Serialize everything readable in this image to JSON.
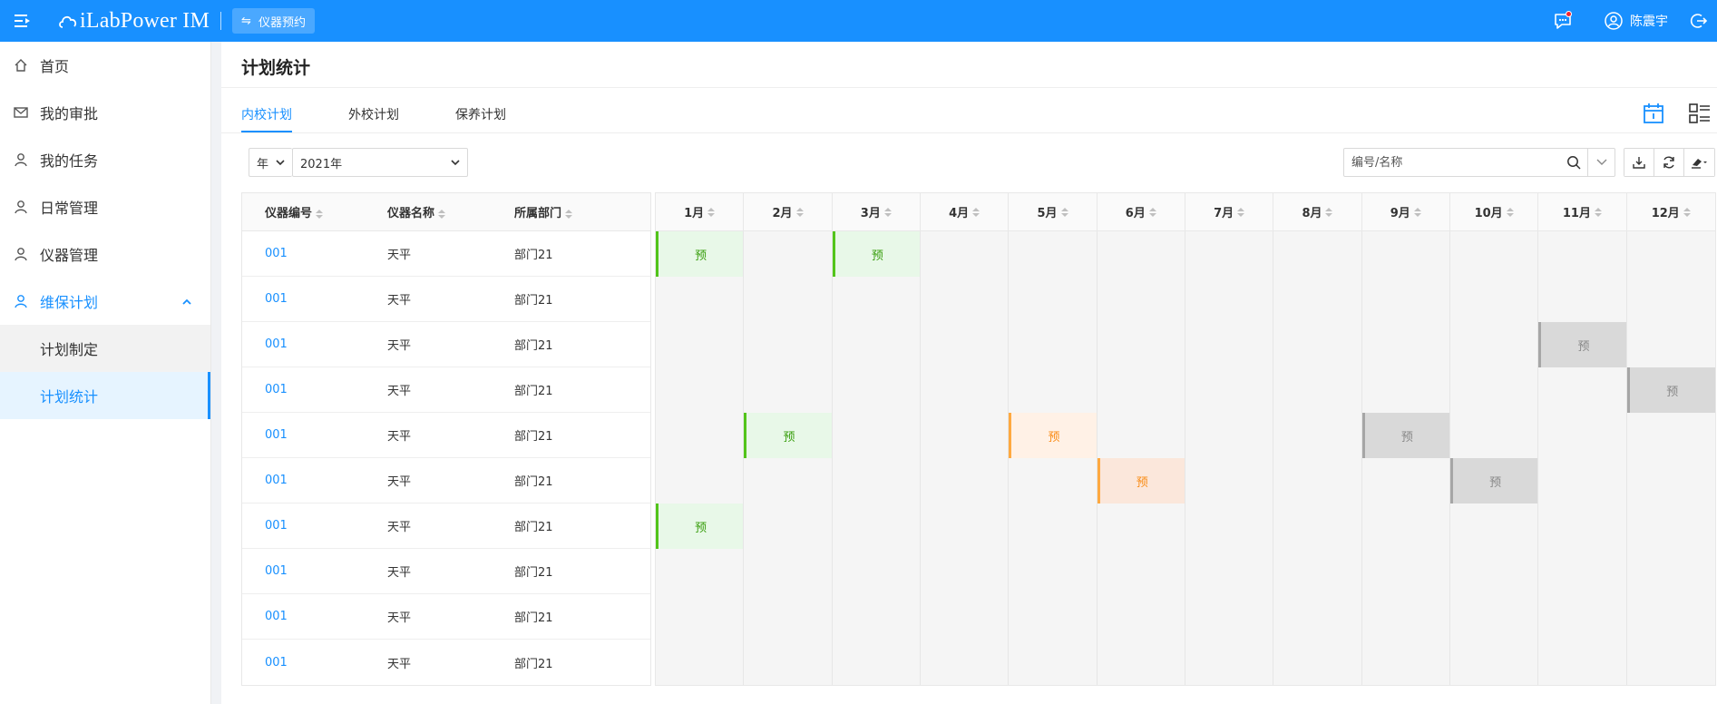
{
  "app": {
    "logo_text": "iLabPower IM",
    "nav_chip_label": "仪器预约",
    "user_name": "陈震宇"
  },
  "colors": {
    "primary": "#1890ff",
    "green": "#52c41a",
    "orange": "#fa8c16",
    "gray": "#a6a6a6"
  },
  "sidebar": {
    "items": [
      {
        "label": "首页",
        "icon": "home-icon"
      },
      {
        "label": "我的审批",
        "icon": "mail-icon"
      },
      {
        "label": "我的任务",
        "icon": "user-icon"
      },
      {
        "label": "日常管理",
        "icon": "user-icon"
      },
      {
        "label": "仪器管理",
        "icon": "user-icon"
      },
      {
        "label": "维保计划",
        "icon": "user-icon"
      }
    ],
    "sub_items": [
      {
        "label": "计划制定"
      },
      {
        "label": "计划统计"
      }
    ]
  },
  "page": {
    "title": "计划统计"
  },
  "tabs": [
    {
      "label": "内校计划"
    },
    {
      "label": "外校计划"
    },
    {
      "label": "保养计划"
    }
  ],
  "filters": {
    "unit": "年",
    "year": "2021年"
  },
  "search": {
    "placeholder": "编号/名称"
  },
  "table": {
    "headers": [
      "仪器编号",
      "仪器名称",
      "所属部门"
    ],
    "rows": [
      [
        "001",
        "天平",
        "部门21"
      ],
      [
        "001",
        "天平",
        "部门21"
      ],
      [
        "001",
        "天平",
        "部门21"
      ],
      [
        "001",
        "天平",
        "部门21"
      ],
      [
        "001",
        "天平",
        "部门21"
      ],
      [
        "001",
        "天平",
        "部门21"
      ],
      [
        "001",
        "天平",
        "部门21"
      ],
      [
        "001",
        "天平",
        "部门21"
      ],
      [
        "001",
        "天平",
        "部门21"
      ],
      [
        "001",
        "天平",
        "部门21"
      ]
    ]
  },
  "calendar": {
    "months": [
      "1月",
      "2月",
      "3月",
      "4月",
      "5月",
      "6月",
      "7月",
      "8月",
      "9月",
      "10月",
      "11月",
      "12月"
    ],
    "marker_label": "预",
    "cells": [
      [
        "green",
        "",
        "green",
        "",
        "",
        "",
        "",
        "",
        "",
        "",
        "",
        ""
      ],
      [
        "",
        "",
        "",
        "",
        "",
        "",
        "",
        "",
        "",
        "",
        "",
        ""
      ],
      [
        "",
        "",
        "",
        "",
        "",
        "",
        "",
        "",
        "",
        "",
        "gray",
        ""
      ],
      [
        "",
        "",
        "",
        "",
        "",
        "",
        "",
        "",
        "",
        "",
        "",
        "gray"
      ],
      [
        "",
        "green",
        "",
        "",
        "orange",
        "",
        "",
        "",
        "gray",
        "",
        "",
        ""
      ],
      [
        "",
        "",
        "",
        "",
        "",
        "orange2",
        "",
        "",
        "",
        "gray",
        "",
        ""
      ],
      [
        "green",
        "",
        "",
        "",
        "",
        "",
        "",
        "",
        "",
        "",
        "",
        ""
      ],
      [
        "",
        "",
        "",
        "",
        "",
        "",
        "",
        "",
        "",
        "",
        "",
        ""
      ],
      [
        "",
        "",
        "",
        "",
        "",
        "",
        "",
        "",
        "",
        "",
        "",
        ""
      ],
      [
        "",
        "",
        "",
        "",
        "",
        "",
        "",
        "",
        "",
        "",
        "",
        ""
      ]
    ]
  }
}
